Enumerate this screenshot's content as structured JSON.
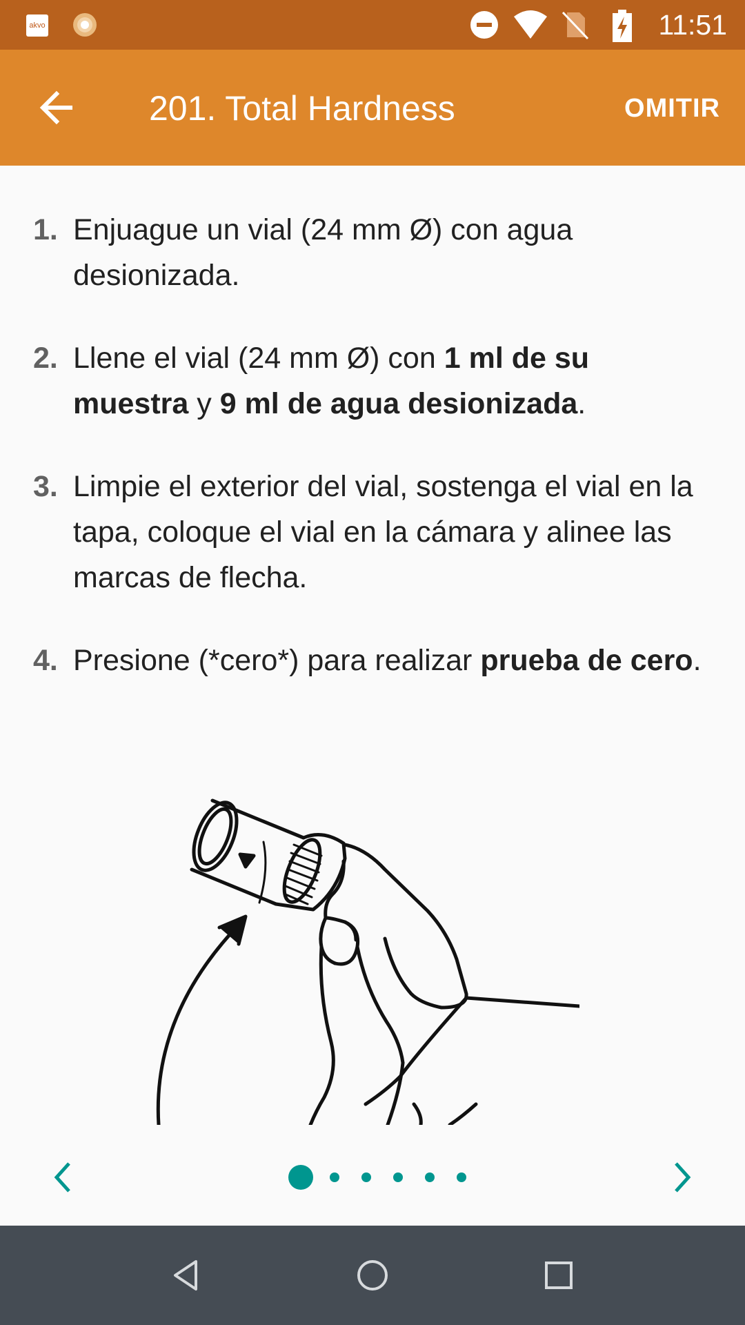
{
  "status_bar": {
    "time": "11:51",
    "app_icons": [
      "akvo-icon",
      "sun-icon"
    ],
    "akvo_label": "akvo",
    "icons": [
      "do-not-disturb-icon",
      "wifi-icon",
      "no-sim-icon",
      "battery-charging-icon"
    ]
  },
  "app_bar": {
    "title": "201. Total Hardness",
    "back_icon": "arrow-left-icon",
    "skip_label": "OMITIR"
  },
  "steps": [
    {
      "number": "1.",
      "parts": [
        {
          "text": "Enjuague un vial (24 mm Ø) con agua desionizada.",
          "bold": false
        }
      ]
    },
    {
      "number": "2.",
      "parts": [
        {
          "text": "Llene el vial (24 mm Ø) con ",
          "bold": false
        },
        {
          "text": "1 ml de su muestra",
          "bold": true
        },
        {
          "text": " y ",
          "bold": false
        },
        {
          "text": "9 ml de agua desionizada",
          "bold": true
        },
        {
          "text": ".",
          "bold": false
        }
      ]
    },
    {
      "number": "3.",
      "parts": [
        {
          "text": "Limpie el exterior del vial, sostenga el vial en la tapa, coloque el vial en la cámara y alinee las marcas de flecha.",
          "bold": false
        }
      ]
    },
    {
      "number": "4.",
      "parts": [
        {
          "text": "Presione (*cero*) para realizar ",
          "bold": false
        },
        {
          "text": "prueba de cero",
          "bold": true
        },
        {
          "text": ".",
          "bold": false
        }
      ]
    }
  ],
  "illustration": {
    "icon": "hand-holding-vial-illustration"
  },
  "pager": {
    "prev_icon": "chevron-left-icon",
    "next_icon": "chevron-right-icon",
    "page_count": 6,
    "current_page": 1,
    "accent_color": "#00968f"
  },
  "colors": {
    "status_bar": "#b8611d",
    "app_bar": "#de872b",
    "nav_bar": "#454c54"
  },
  "nav_bar": {
    "buttons": [
      "back-triangle-icon",
      "home-circle-icon",
      "recents-square-icon"
    ]
  }
}
